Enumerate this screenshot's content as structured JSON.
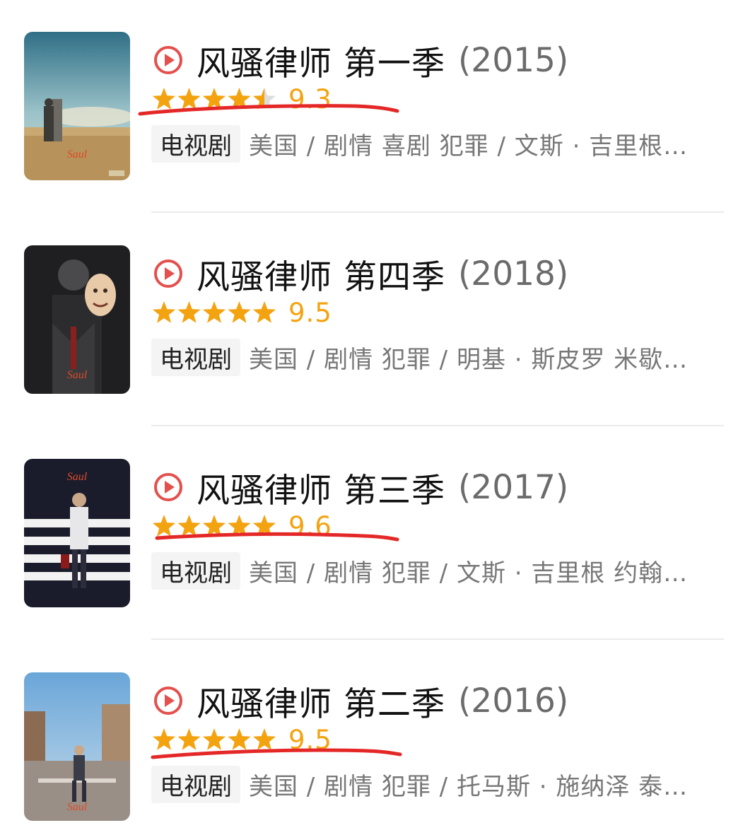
{
  "items": [
    {
      "title": "风骚律师 第一季",
      "year": "(2015)",
      "score": "9.3",
      "rating": 4.5,
      "tag": "电视剧",
      "meta": "美国 / 剧情 喜剧 犯罪 / 文斯 · 吉里根…",
      "underlined": true,
      "poster_theme": "desert"
    },
    {
      "title": "风骚律师 第四季",
      "year": "(2018)",
      "score": "9.5",
      "rating": 5,
      "tag": "电视剧",
      "meta": "美国 / 剧情 犯罪 / 明基 · 斯皮罗 米歇…",
      "underlined": false,
      "poster_theme": "dark"
    },
    {
      "title": "风骚律师 第三季",
      "year": "(2017)",
      "score": "9.6",
      "rating": 5,
      "tag": "电视剧",
      "meta": "美国 / 剧情 犯罪 / 文斯 · 吉里根 约翰…",
      "underlined": true,
      "poster_theme": "stripes"
    },
    {
      "title": "风骚律师 第二季",
      "year": "(2016)",
      "score": "9.5",
      "rating": 5,
      "tag": "电视剧",
      "meta": "美国 / 剧情 犯罪 / 托马斯 · 施纳泽 泰…",
      "underlined": true,
      "poster_theme": "street"
    }
  ],
  "colors": {
    "play_icon": "#e3504d",
    "star": "#f4a310",
    "star_empty": "#dddddd",
    "underline": "#e42828"
  }
}
